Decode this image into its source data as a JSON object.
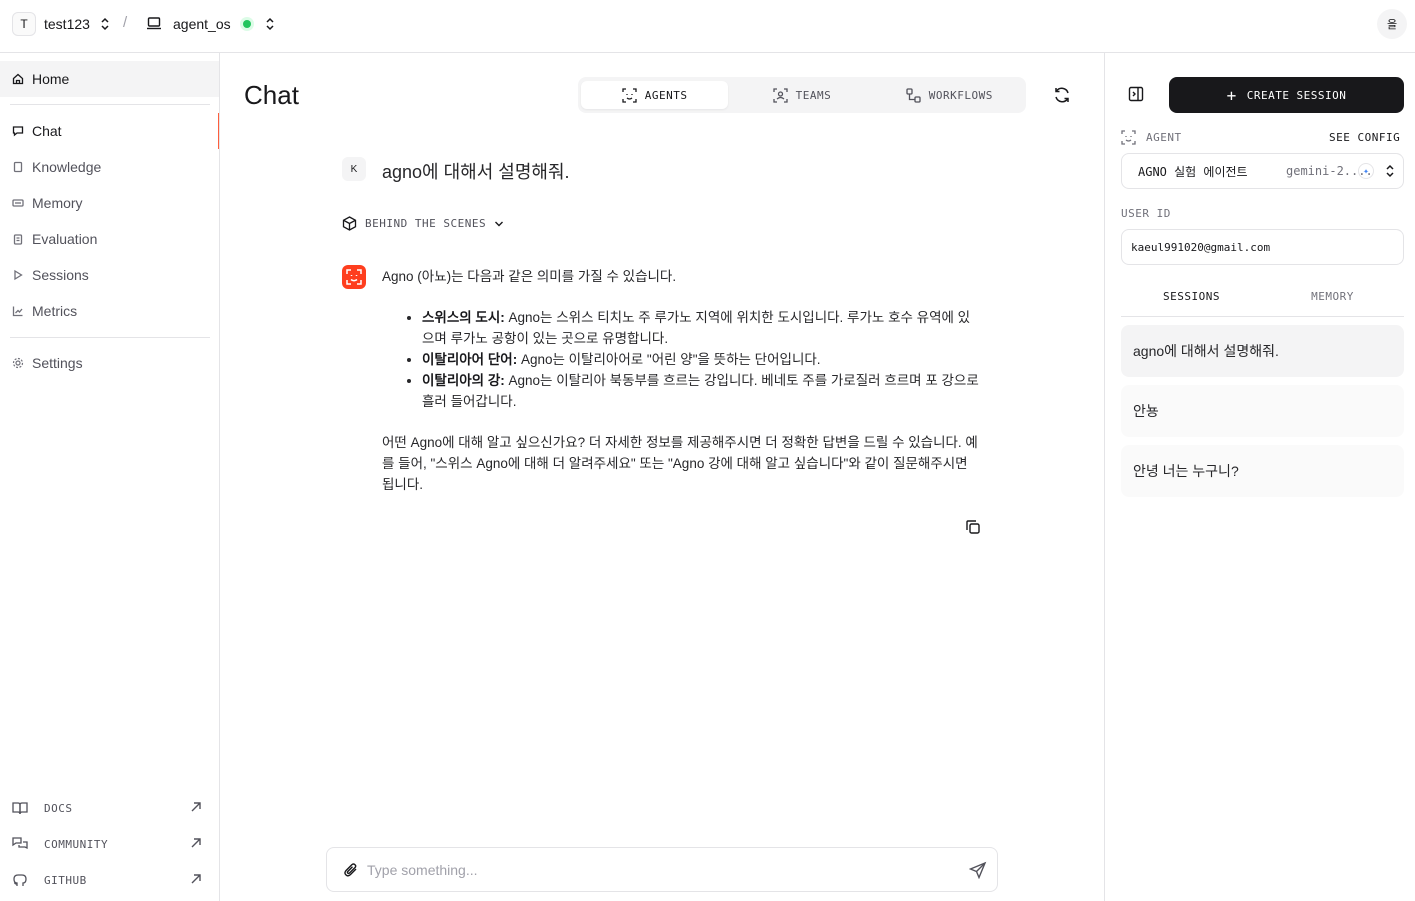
{
  "topbar": {
    "org_initial": "T",
    "org_name": "test123",
    "separator": "/",
    "os_name": "agent_os",
    "status_color": "#22c55e",
    "user_initial": "을"
  },
  "sidebar": {
    "items": [
      {
        "label": "Home",
        "icon": "home-icon"
      },
      {
        "label": "Chat",
        "icon": "chat-icon"
      },
      {
        "label": "Knowledge",
        "icon": "file-icon"
      },
      {
        "label": "Memory",
        "icon": "memory-icon"
      },
      {
        "label": "Evaluation",
        "icon": "clipboard-icon"
      },
      {
        "label": "Sessions",
        "icon": "play-icon"
      },
      {
        "label": "Metrics",
        "icon": "chart-icon"
      },
      {
        "label": "Settings",
        "icon": "gear-icon"
      }
    ],
    "links": [
      {
        "label": "DOCS",
        "icon": "book-icon"
      },
      {
        "label": "COMMUNITY",
        "icon": "community-icon"
      },
      {
        "label": "GITHUB",
        "icon": "github-icon"
      }
    ]
  },
  "main": {
    "title": "Chat",
    "tabs": [
      {
        "label": "AGENTS"
      },
      {
        "label": "TEAMS"
      },
      {
        "label": "WORKFLOWS"
      }
    ],
    "user_initial": "K",
    "user_message": "agno에 대해서 설명해줘.",
    "behind_scenes": "BEHIND THE SCENES",
    "agent_response": {
      "intro": "Agno (아뇨)는 다음과 같은 의미를 가질 수 있습니다.",
      "bullets": [
        {
          "term": "스위스의 도시:",
          "text": " Agno는 스위스 티치노 주 루가노 지역에 위치한 도시입니다. 루가노 호수 유역에 있으며 루가노 공항이 있는 곳으로 유명합니다."
        },
        {
          "term": "이탈리아어 단어:",
          "text": " Agno는 이탈리아어로 \"어린 양\"을 뜻하는 단어입니다."
        },
        {
          "term": "이탈리아의 강:",
          "text": " Agno는 이탈리아 북동부를 흐르는 강입니다. 베네토 주를 가로질러 흐르며 포 강으로 흘러 들어갑니다."
        }
      ],
      "outro": "어떤 Agno에 대해 알고 싶으신가요? 더 자세한 정보를 제공해주시면 더 정확한 답변을 드릴 수 있습니다. 예를 들어, \"스위스 Agno에 대해 더 알려주세요\" 또는 \"Agno 강에 대해 알고 싶습니다\"와 같이 질문해주시면 됩니다."
    },
    "composer_placeholder": "Type something...",
    "composer_value": ""
  },
  "panel": {
    "create_label": "CREATE SESSION",
    "agent_label": "AGENT",
    "see_config": "SEE CONFIG",
    "agent_name": "AGNO 실험 에이전트",
    "model": "gemini-2....",
    "user_id_label": "USER ID",
    "user_id": "kaeul991020@gmail.com",
    "tabs": [
      {
        "label": "SESSIONS"
      },
      {
        "label": "MEMORY"
      }
    ],
    "sessions": [
      {
        "title": "agno에 대해서 설명해줘."
      },
      {
        "title": "안뇽"
      },
      {
        "title": "안녕 너는 누구니?"
      }
    ]
  },
  "colors": {
    "accent": "#fe3e1e",
    "chat_indicator": "#fe5e3d",
    "primary_button": "#18181b"
  }
}
